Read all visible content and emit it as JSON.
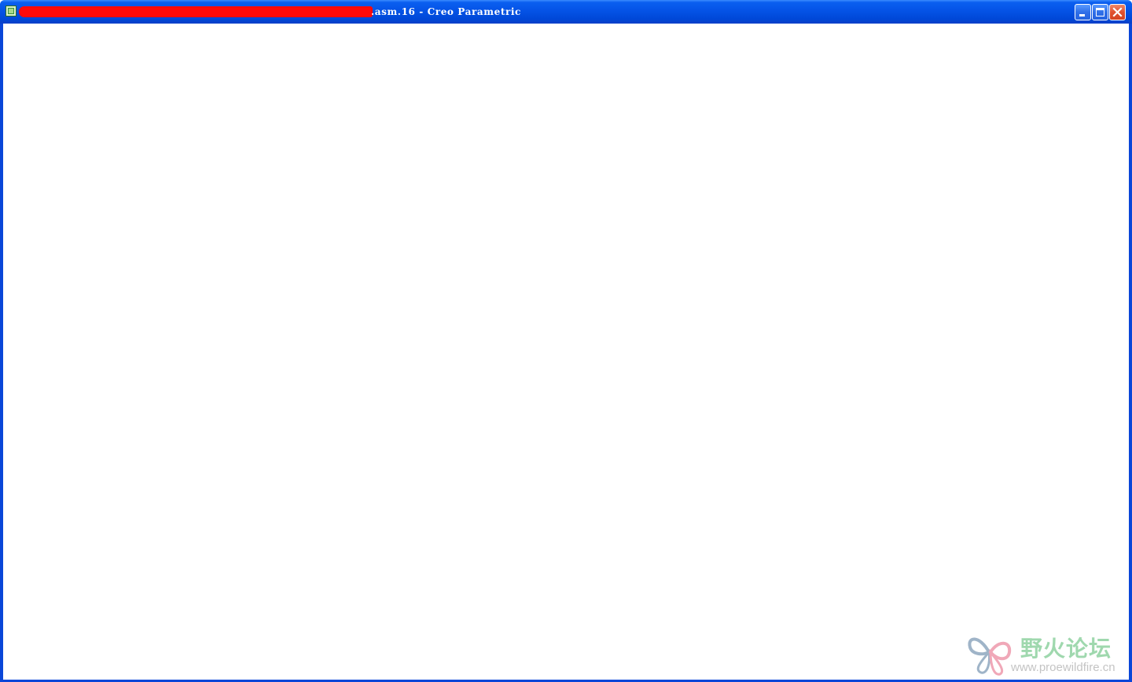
{
  "window": {
    "title": ".asm.16 - Creo Parametric",
    "title_redacted": true,
    "icon": "creo-app-icon",
    "controls": {
      "minimize": "minimize-icon",
      "maximize": "maximize-icon",
      "close": "close-icon"
    }
  },
  "watermark": {
    "name": "野火论坛",
    "url": "www.proewildfire.cn",
    "logo": "butterfly-logo"
  },
  "colors": {
    "titlebar": "#0553e6",
    "redaction": "#ff0a0a",
    "client": "#ffffff",
    "close_button": "#e0512f",
    "watermark_text": "#8fd2a0"
  }
}
